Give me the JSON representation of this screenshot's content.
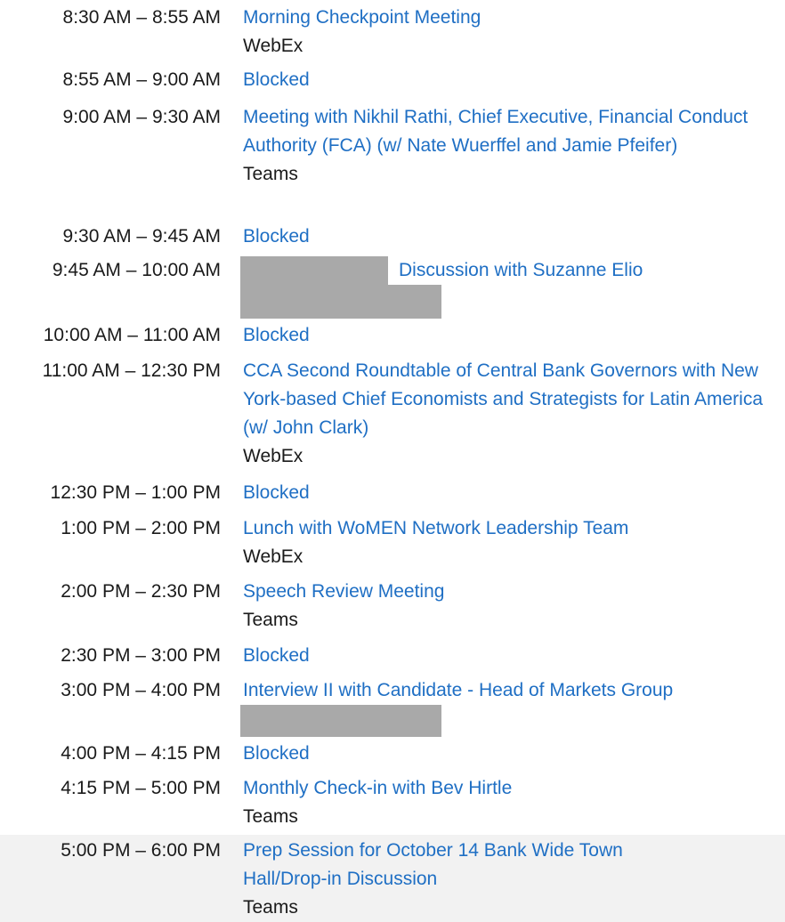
{
  "schedule": [
    {
      "time": "8:30 AM – 8:55 AM",
      "title": "Morning Checkpoint Meeting",
      "location": "WebEx"
    },
    {
      "time": "8:55 AM – 9:00 AM",
      "title": "Blocked",
      "location": ""
    },
    {
      "time": "9:00 AM – 9:30 AM",
      "title": "Meeting with Nikhil Rathi, Chief Executive, Financial Conduct Authority (FCA) (w/ Nate Wuerffel and Jamie Pfeifer)",
      "location": "Teams"
    },
    {
      "time": "9:30 AM – 9:45 AM",
      "title": "Blocked",
      "location": ""
    },
    {
      "time": "9:45 AM – 10:00 AM",
      "title": "Discussion with Suzanne Elio",
      "location": ""
    },
    {
      "time": "10:00 AM – 11:00 AM",
      "title": "Blocked",
      "location": ""
    },
    {
      "time": "11:00 AM – 12:30 PM",
      "title": "CCA Second Roundtable of Central Bank Governors with New York-based Chief Economists and Strategists for Latin America (w/ John Clark)",
      "location": "WebEx"
    },
    {
      "time": "12:30 PM – 1:00 PM",
      "title": "Blocked",
      "location": ""
    },
    {
      "time": "1:00 PM – 2:00 PM",
      "title": "Lunch with WoMEN Network Leadership Team",
      "location": "WebEx"
    },
    {
      "time": "2:00 PM – 2:30 PM",
      "title": "Speech Review Meeting",
      "location": "Teams"
    },
    {
      "time": "2:30 PM – 3:00 PM",
      "title": "Blocked",
      "location": ""
    },
    {
      "time": "3:00 PM – 4:00 PM",
      "title": "Interview II with Candidate - Head of Markets Group",
      "location": ""
    },
    {
      "time": "4:00 PM – 4:15 PM",
      "title": "Blocked",
      "location": ""
    },
    {
      "time": "4:15 PM – 5:00 PM",
      "title": "Monthly Check-in with Bev Hirtle",
      "location": "Teams"
    },
    {
      "time": "5:00 PM – 6:00 PM",
      "title": "Prep Session for October 14 Bank Wide Town Hall/Drop-in Discussion",
      "location": "Teams"
    }
  ],
  "colors": {
    "link": "#1f6fc4",
    "text": "#1a1a1a",
    "redaction": "#a9a9a9",
    "shaded_row": "#f2f2f2"
  }
}
